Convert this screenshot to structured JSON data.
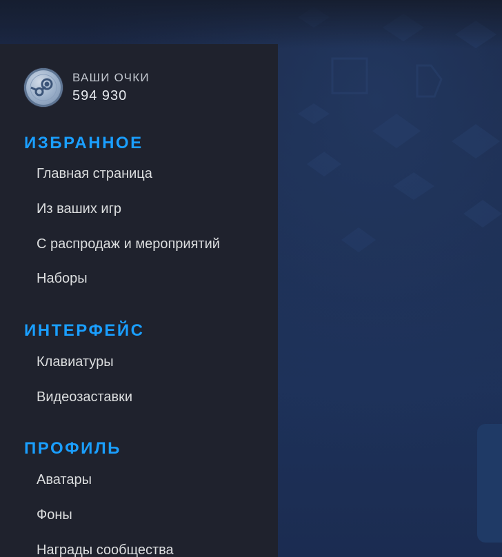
{
  "points": {
    "label": "ВАШИ ОЧКИ",
    "value": "594 930",
    "icon": "steam-logo-icon"
  },
  "sections": [
    {
      "title": "ИЗБРАННОЕ",
      "items": [
        "Главная страница",
        "Из ваших игр",
        "С распродаж и мероприятий",
        "Наборы"
      ]
    },
    {
      "title": "ИНТЕРФЕЙС",
      "items": [
        "Клавиатуры",
        "Видеозаставки"
      ]
    },
    {
      "title": "ПРОФИЛЬ",
      "items": [
        "Аватары",
        "Фоны",
        "Награды сообщества"
      ]
    }
  ],
  "colors": {
    "accent": "#1a9fff",
    "sidebar_bg": "#1f222d",
    "page_bg": "#1d3159",
    "text": "#dcdedf"
  }
}
